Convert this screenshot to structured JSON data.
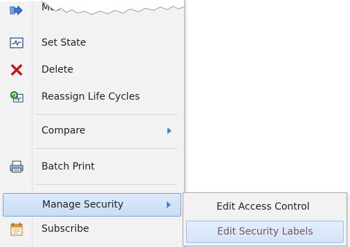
{
  "menu": {
    "items": [
      {
        "label": "Move",
        "icon": "move-icon"
      },
      {
        "label": "Set State",
        "icon": "set-state-icon"
      },
      {
        "label": "Delete",
        "icon": "delete-icon"
      },
      {
        "label": "Reassign Life Cycles",
        "icon": "reassign-lifecycle-icon"
      },
      {
        "label": "Compare",
        "icon": "",
        "submenu": true
      },
      {
        "label": "Batch Print",
        "icon": "batch-print-icon"
      },
      {
        "label": "Manage Security",
        "icon": "",
        "submenu": true,
        "active": true
      },
      {
        "label": "Subscribe",
        "icon": "subscribe-icon"
      }
    ]
  },
  "submenu": {
    "items": [
      {
        "label": "Edit Access Control"
      },
      {
        "label": "Edit Security Labels",
        "hovered": true
      }
    ]
  },
  "colors": {
    "menu_bg": "#f2f2f2",
    "highlight_border": "#7da2ce",
    "arrow": "#4a7fd0",
    "delete_red": "#c4121a"
  }
}
